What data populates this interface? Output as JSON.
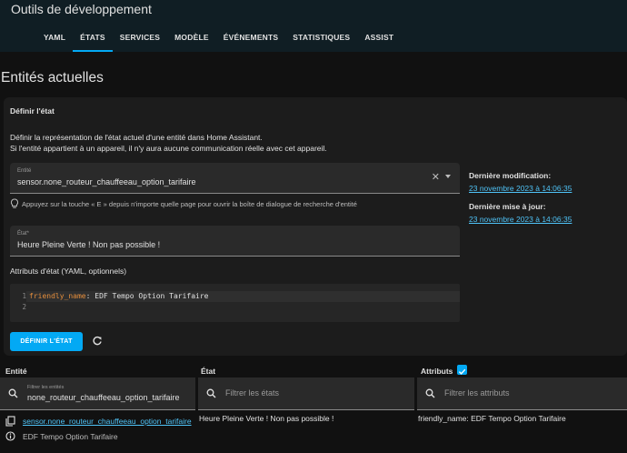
{
  "app": {
    "title": "Outils de développement",
    "tabs": [
      {
        "label": "YAML",
        "active": false
      },
      {
        "label": "ÉTATS",
        "active": true
      },
      {
        "label": "SERVICES",
        "active": false
      },
      {
        "label": "MODÈLE",
        "active": false
      },
      {
        "label": "ÉVÉNEMENTS",
        "active": false
      },
      {
        "label": "STATISTIQUES",
        "active": false
      },
      {
        "label": "ASSIST",
        "active": false
      }
    ]
  },
  "page": {
    "title": "Entités actuelles"
  },
  "set_state": {
    "title": "Définir l'état",
    "description_1": "Définir la représentation de l'état actuel d'une entité dans Home Assistant.",
    "description_2": "Si l'entité appartient à un appareil, il n'y aura aucune communication réelle avec cet appareil.",
    "entity_label": "Entité",
    "entity_value": "sensor.none_routeur_chauffeeau_option_tarifaire",
    "hint": "Appuyez sur la touche « E » depuis n'importe quelle page pour ouvrir la boîte de dialogue de recherche d'entité",
    "state_label": "État*",
    "state_value": "Heure Pleine Verte ! Non pas possible !",
    "attributes_label": "Attributs d'état (YAML, optionnels)",
    "code_key": "friendly_name",
    "code_value": "EDF Tempo Option Tarifaire",
    "button_label": "DÉFINIR L'ÉTAT",
    "last_changed_label": "Dernière modification:",
    "last_changed_value": "23 novembre 2023 à 14:06:35",
    "last_updated_label": "Dernière mise à jour:",
    "last_updated_value": "23 novembre 2023 à 14:06:35"
  },
  "table": {
    "col_entity": "Entité",
    "col_state": "État",
    "col_attributes": "Attributs",
    "attributes_checked": true,
    "filter_entity_label": "Filtrer les entités",
    "filter_entity_value": "none_routeur_chauffeeau_option_tarifaire",
    "filter_state_placeholder": "Filtrer les états",
    "filter_attr_placeholder": "Filtrer les attributs",
    "row": {
      "entity_id": "sensor.none_routeur_chauffeeau_option_tarifaire",
      "friendly_name": "EDF Tempo Option Tarifaire",
      "state": "Heure Pleine Verte ! Non pas possible !",
      "attributes": "friendly_name: EDF Tempo Option Tarifaire"
    }
  },
  "colors": {
    "accent": "#03a9f4",
    "header_bg": "#101e24",
    "card_bg": "#1c1c1c",
    "code_key": "#e58e3c"
  }
}
